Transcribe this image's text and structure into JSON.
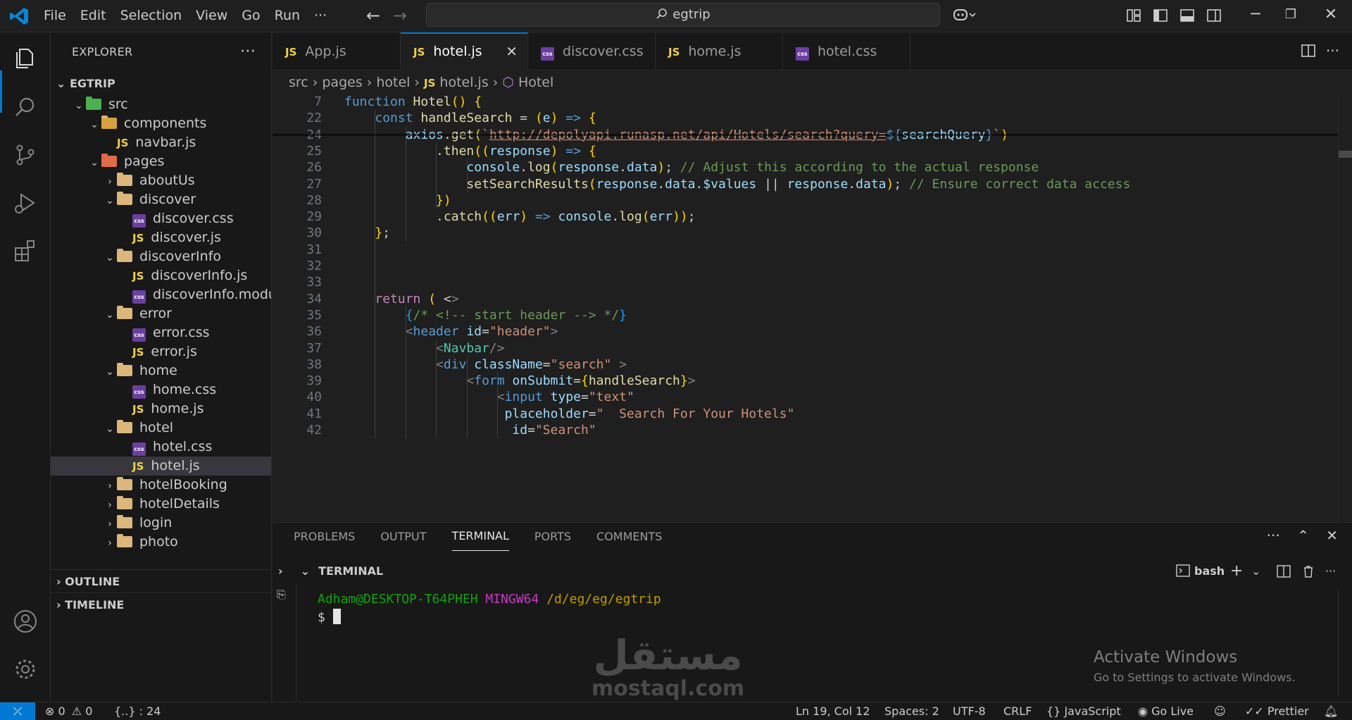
{
  "titlebar": {
    "menus": [
      "File",
      "Edit",
      "Selection",
      "View",
      "Go",
      "Run",
      "···"
    ],
    "search": "egtrip"
  },
  "explorer": {
    "title": "EXPLORER",
    "root": "EGTRIP",
    "tree": [
      {
        "label": "src",
        "kind": "folder-src",
        "depth": 1,
        "open": true
      },
      {
        "label": "components",
        "kind": "folder-special",
        "depth": 2,
        "open": true
      },
      {
        "label": "navbar.js",
        "kind": "js",
        "depth": 3
      },
      {
        "label": "pages",
        "kind": "folder-pages",
        "depth": 2,
        "open": true
      },
      {
        "label": "aboutUs",
        "kind": "folder",
        "depth": 3,
        "open": false
      },
      {
        "label": "discover",
        "kind": "folder",
        "depth": 3,
        "open": true
      },
      {
        "label": "discover.css",
        "kind": "css",
        "depth": 4
      },
      {
        "label": "discover.js",
        "kind": "js",
        "depth": 4
      },
      {
        "label": "discoverInfo",
        "kind": "folder",
        "depth": 3,
        "open": true
      },
      {
        "label": "discoverInfo.js",
        "kind": "js",
        "depth": 4
      },
      {
        "label": "discoverInfo.module....",
        "kind": "css",
        "depth": 4
      },
      {
        "label": "error",
        "kind": "folder",
        "depth": 3,
        "open": true
      },
      {
        "label": "error.css",
        "kind": "css",
        "depth": 4
      },
      {
        "label": "error.js",
        "kind": "js",
        "depth": 4
      },
      {
        "label": "home",
        "kind": "folder",
        "depth": 3,
        "open": true
      },
      {
        "label": "home.css",
        "kind": "css",
        "depth": 4
      },
      {
        "label": "home.js",
        "kind": "js",
        "depth": 4
      },
      {
        "label": "hotel",
        "kind": "folder",
        "depth": 3,
        "open": true
      },
      {
        "label": "hotel.css",
        "kind": "css",
        "depth": 4
      },
      {
        "label": "hotel.js",
        "kind": "js",
        "depth": 4,
        "selected": true
      },
      {
        "label": "hotelBooking",
        "kind": "folder",
        "depth": 3,
        "open": false
      },
      {
        "label": "hotelDetails",
        "kind": "folder",
        "depth": 3,
        "open": false
      },
      {
        "label": "login",
        "kind": "folder",
        "depth": 3,
        "open": false
      },
      {
        "label": "photo",
        "kind": "folder",
        "depth": 3,
        "open": false
      }
    ],
    "outline": "OUTLINE",
    "timeline": "TIMELINE"
  },
  "tabs": [
    {
      "label": "App.js",
      "kind": "js"
    },
    {
      "label": "hotel.js",
      "kind": "js",
      "active": true
    },
    {
      "label": "discover.css",
      "kind": "css"
    },
    {
      "label": "home.js",
      "kind": "js"
    },
    {
      "label": "hotel.css",
      "kind": "css"
    }
  ],
  "breadcrumb": [
    "src",
    "pages",
    "hotel",
    "hotel.js",
    "Hotel"
  ],
  "editor": {
    "line_numbers": [
      "7",
      "22",
      "24",
      "25",
      "26",
      "27",
      "28",
      "29",
      "30",
      "31",
      "32",
      "33",
      "34",
      "35",
      "36",
      "37",
      "38",
      "39",
      "40",
      "41",
      "42"
    ],
    "lines": [
      "function Hotel() {",
      "    const handleSearch = (e) => {",
      "        axios.get(`http://depolyapi.runasp.net/api/Hotels/search?query=${searchQuery}`)",
      "            .then((response) => {",
      "                console.log(response.data); // Adjust this according to the actual response",
      "                setSearchResults(response.data.$values || response.data); // Ensure correct data access",
      "            })",
      "            .catch((err) => console.log(err));",
      "    };",
      "",
      "",
      "",
      "    return ( <>",
      "        {/* <!-- start header --> */}",
      "        <header id=\"header\">",
      "            <Navbar/>",
      "            <div className=\"search\" >",
      "                <form onSubmit={handleSearch}>",
      "                    <input type=\"text\"",
      "                     placeholder=\"  Search For Your Hotels\"",
      "                      id=\"Search\""
    ]
  },
  "panel": {
    "tabs": [
      "PROBLEMS",
      "OUTPUT",
      "TERMINAL",
      "PORTS",
      "COMMENTS"
    ],
    "active_tab": "TERMINAL",
    "terminal_title": "TERMINAL",
    "shell": "bash",
    "prompt_user": "Adham@DESKTOP-T64PHEH",
    "prompt_env": "MINGW64",
    "prompt_path": "/d/eg/eg/egtrip",
    "prompt_symbol": "$"
  },
  "watermark": {
    "activate_title": "Activate Windows",
    "activate_sub": "Go to Settings to activate Windows.",
    "brand_ar": "مستقل",
    "brand_en": "mostaql.com"
  },
  "statusbar": {
    "errors": "0",
    "warnings": "0",
    "braces": "{..} : 24",
    "position": "Ln 19, Col 12",
    "spaces": "Spaces: 2",
    "encoding": "UTF-8",
    "eol": "CRLF",
    "language": "JavaScript",
    "golive": "Go Live",
    "prettier": "Prettier"
  },
  "colors": {
    "accent": "#0078d4",
    "background": "#1f1f1f",
    "sidebar": "#181818"
  }
}
